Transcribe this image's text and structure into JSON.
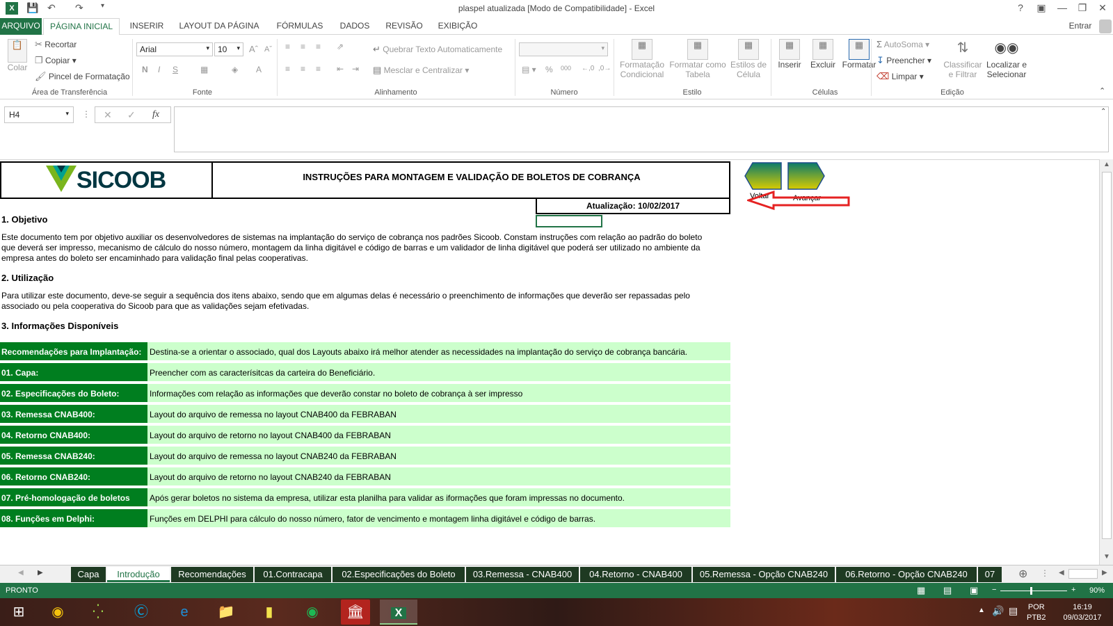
{
  "window": {
    "title": "plaspel atualizada  [Modo de Compatibilidade] - Excel",
    "signin": "Entrar"
  },
  "ribbon_tabs": [
    "ARQUIVO",
    "PÁGINA INICIAL",
    "INSERIR",
    "LAYOUT DA PÁGINA",
    "FÓRMULAS",
    "DADOS",
    "REVISÃO",
    "EXIBIÇÃO"
  ],
  "clipboard": {
    "paste": "Colar",
    "cut": "Recortar",
    "copy": "Copiar",
    "painter": "Pincel de Formatação",
    "label": "Área de Transferência"
  },
  "font": {
    "name": "Arial",
    "size": "10",
    "label": "Fonte"
  },
  "alignment": {
    "wrap": "Quebrar Texto Automaticamente",
    "merge": "Mesclar e Centralizar",
    "label": "Alinhamento"
  },
  "number": {
    "label": "Número"
  },
  "styles": {
    "conditional": [
      "Formatação",
      "Condicional"
    ],
    "table": [
      "Formatar como",
      "Tabela"
    ],
    "cell": [
      "Estilos de",
      "Célula"
    ],
    "label": "Estilo"
  },
  "cells": {
    "insert": "Inserir",
    "delete": "Excluir",
    "format": "Formatar",
    "label": "Células"
  },
  "editing": {
    "autosum": "AutoSoma",
    "fill": "Preencher",
    "clear": "Limpar",
    "sort": [
      "Classificar",
      "e Filtrar"
    ],
    "find": [
      "Localizar e",
      "Selecionar"
    ],
    "label": "Edição"
  },
  "formula_bar": {
    "name_box": "H4",
    "value": ""
  },
  "sheet": {
    "logo": "SICOOB",
    "header": "INSTRUÇÕES PARA MONTAGEM E VALIDAÇÃO DE BOLETOS DE COBRANÇA",
    "update": "Atualização: 10/02/2017",
    "nav_back": "Voltar",
    "nav_next": "Avançar",
    "s1_title": "1. Objetivo",
    "s1_text": [
      "Este documento tem por objetivo auxiliar os desenvolvedores de sistemas na implantação do serviço de cobrança nos padrões Sicoob. Constam instruções com relação ao padrão do boleto",
      "que deverá ser impresso, mecanismo de cálculo do nosso número, montagem da linha digitável e código de barras e um validador de linha digitável que poderá ser utilizado  no ambiente da",
      "empresa antes do boleto ser encaminhado para validação final pelas cooperativas."
    ],
    "s2_title": "2. Utilização",
    "s2_text": [
      "Para utilizar este documento, deve-se seguir a sequência dos itens abaixo, sendo que em algumas delas é necessário o preenchimento de informações que deverão ser repassadas pelo",
      "associado ou pela cooperativa do Sicoob para que as validações sejam efetivadas."
    ],
    "s3_title": "3. Informações Disponíveis",
    "rows": [
      {
        "label": "Recomendações para Implantação:",
        "desc": "Destina-se a orientar o associado, qual dos Layouts abaixo irá melhor atender as necessidades na implantação do serviço de cobrança bancária."
      },
      {
        "label": "01. Capa:",
        "desc": "Preencher com as caracterísitcas da carteira do Beneficiário."
      },
      {
        "label": "02. Especificações do Boleto:",
        "desc": "Informações com relação as informações que deverão constar no boleto de cobrança à ser impresso"
      },
      {
        "label": "03. Remessa CNAB400:",
        "desc": "Layout do arquivo de remessa no layout CNAB400 da FEBRABAN"
      },
      {
        "label": "04. Retorno CNAB400:",
        "desc": "Layout do arquivo de retorno no layout CNAB400 da FEBRABAN"
      },
      {
        "label": "05. Remessa CNAB240:",
        "desc": "Layout do arquivo de remessa no layout CNAB240 da FEBRABAN"
      },
      {
        "label": "06. Retorno CNAB240:",
        "desc": "Layout do arquivo de retorno no layout CNAB240 da FEBRABAN"
      },
      {
        "label": "07. Pré-homologação de boletos",
        "desc": "Após gerar boletos no sistema da empresa, utilizar esta planilha para validar as iformações que foram impressas no documento."
      },
      {
        "label": "08. Funções em Delphi:",
        "desc": "Funções em DELPHI para cálculo do nosso número, fator de vencimento e montagem linha digitável e código de barras."
      }
    ]
  },
  "sheet_tabs": [
    "Capa",
    "Introdução",
    "Recomendações",
    "01.Contracapa",
    "02.Especificações do Boleto",
    "03.Remessa - CNAB400",
    "04.Retorno - CNAB400",
    "05.Remessa - Opção CNAB240",
    "06.Retorno - Opção CNAB240",
    "07"
  ],
  "status": {
    "mode": "PRONTO",
    "zoom": "90%"
  },
  "taskbar": {
    "lang1": "POR",
    "lang2": "PTB2",
    "time": "16:19",
    "date": "09/03/2017"
  },
  "colors": {
    "excel_green": "#217346",
    "row_label": "#007e1f",
    "row_desc": "#ccffcc"
  }
}
